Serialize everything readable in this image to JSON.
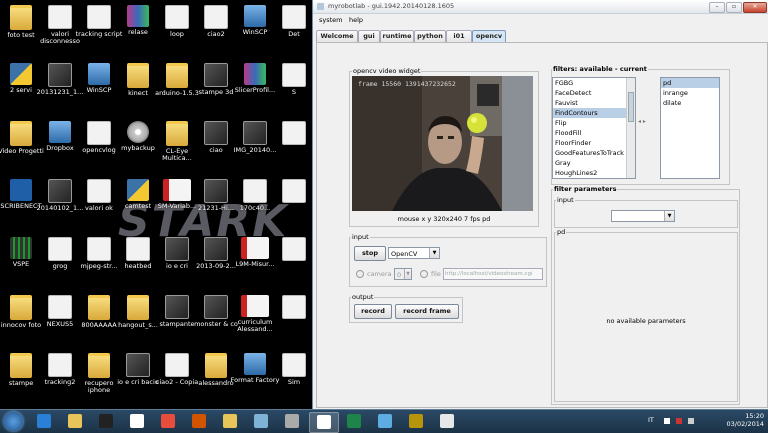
{
  "desktop": {
    "watermark": "STARK",
    "icons": [
      {
        "label": "foto test",
        "kind": "folder"
      },
      {
        "label": "valori disconnesso",
        "kind": "doc"
      },
      {
        "label": "tracking script",
        "kind": "doc"
      },
      {
        "label": "relase",
        "kind": "zip"
      },
      {
        "label": "loop",
        "kind": "doc"
      },
      {
        "label": "ciao2",
        "kind": "doc"
      },
      {
        "label": "WinSCP",
        "kind": "exe"
      },
      {
        "label": "Det",
        "kind": "doc"
      },
      {
        "label": "2 servi",
        "kind": "py"
      },
      {
        "label": "20131231_1...",
        "kind": "img"
      },
      {
        "label": "WinSCP",
        "kind": "exe"
      },
      {
        "label": "kinect",
        "kind": "folder"
      },
      {
        "label": "arduino-1.5.3",
        "kind": "folder"
      },
      {
        "label": "stampe 3d",
        "kind": "img"
      },
      {
        "label": "SlicerProfil...",
        "kind": "zip"
      },
      {
        "label": "S",
        "kind": "doc"
      },
      {
        "label": "Video Progetti",
        "kind": "folder"
      },
      {
        "label": "Dropbox",
        "kind": "exe"
      },
      {
        "label": "opencvlog",
        "kind": "doc"
      },
      {
        "label": "mybackup",
        "kind": "disc"
      },
      {
        "label": "CL-Eye Multica...",
        "kind": "folder"
      },
      {
        "label": "ciao",
        "kind": "img"
      },
      {
        "label": "IMG_20140...",
        "kind": "img"
      },
      {
        "label": "",
        "kind": "doc"
      },
      {
        "label": "SCRIBENECT",
        "kind": "scribe"
      },
      {
        "label": "20140102_1...",
        "kind": "img"
      },
      {
        "label": "valori ok",
        "kind": "doc"
      },
      {
        "label": "camtest",
        "kind": "py"
      },
      {
        "label": "SM-Variab...",
        "kind": "pdf"
      },
      {
        "label": "21231-Hi...",
        "kind": "img"
      },
      {
        "label": "170c40...",
        "kind": "doc"
      },
      {
        "label": "",
        "kind": "doc"
      },
      {
        "label": "VSPE",
        "kind": "vspe"
      },
      {
        "label": "grog",
        "kind": "doc"
      },
      {
        "label": "mjpeg-str...",
        "kind": "doc"
      },
      {
        "label": "heatbed",
        "kind": "doc"
      },
      {
        "label": "io e cri",
        "kind": "img"
      },
      {
        "label": "2013-09-2...",
        "kind": "img"
      },
      {
        "label": "L9M-Misur...",
        "kind": "pdf"
      },
      {
        "label": "",
        "kind": "doc"
      },
      {
        "label": "innocov foto",
        "kind": "folder"
      },
      {
        "label": "NEXUS5",
        "kind": "doc"
      },
      {
        "label": "800AAAAA",
        "kind": "folder"
      },
      {
        "label": "hangout_s...",
        "kind": "folder"
      },
      {
        "label": "stampante",
        "kind": "img"
      },
      {
        "label": "monster & co",
        "kind": "img"
      },
      {
        "label": "curriculum Alessand...",
        "kind": "pdf"
      },
      {
        "label": "",
        "kind": "doc"
      },
      {
        "label": "stampe",
        "kind": "folder"
      },
      {
        "label": "tracking2",
        "kind": "doc"
      },
      {
        "label": "recupero iphone",
        "kind": "folder"
      },
      {
        "label": "io e cri bacio",
        "kind": "img"
      },
      {
        "label": "ciao2 - Copia",
        "kind": "doc"
      },
      {
        "label": "alessandro",
        "kind": "folder"
      },
      {
        "label": "Format Factory",
        "kind": "exe"
      },
      {
        "label": "Sim",
        "kind": "doc"
      }
    ]
  },
  "taskbar": {
    "language": "IT",
    "time": "15:20",
    "date": "03/02/2014",
    "apps": [
      "ie-icon",
      "explorer-icon",
      "cmd-icon",
      "java-icon",
      "chrome-icon",
      "powerpoint-icon",
      "explorer2-icon",
      "media-icon",
      "settings-icon",
      "java2-icon",
      "excel-icon",
      "network-icon",
      "arduino-icon",
      "notepad-icon"
    ]
  },
  "window": {
    "title": "myrobotlab - gui.1942.20140128.1605",
    "menu": [
      "system",
      "help"
    ],
    "tabs": [
      "Welcome",
      "gui",
      "runtime",
      "python",
      "i01",
      "opencv"
    ],
    "active_tab": "opencv",
    "video_widget": {
      "label": "opencv video widget",
      "overlay": "frame 15560 1391437232652",
      "status": "mouse x y  320x240  7 fps pd"
    },
    "input": {
      "label": "input",
      "stop_label": "stop",
      "grabber": "OpenCV",
      "camera_label": "camera",
      "camera_value": "0",
      "file_label": "file",
      "file_placeholder": "http://localhost/videostream.cgi"
    },
    "output": {
      "label": "output",
      "record_label": "record",
      "record_frame_label": "record frame"
    },
    "filters": {
      "label": "filters: available - current",
      "available": [
        "FGBG",
        "FaceDetect",
        "Fauvist",
        "FindContours",
        "Flip",
        "FloodFill",
        "FloorFinder",
        "GoodFeaturesToTrack",
        "Gray",
        "HoughLines2"
      ],
      "selected_available": "FindContours",
      "current": [
        "pd",
        "inrange",
        "dilate"
      ],
      "selected_current": "pd"
    },
    "parameters": {
      "label": "filter parameters",
      "input_label": "input",
      "pd_label": "pd",
      "empty_text": "no available parameters"
    }
  }
}
